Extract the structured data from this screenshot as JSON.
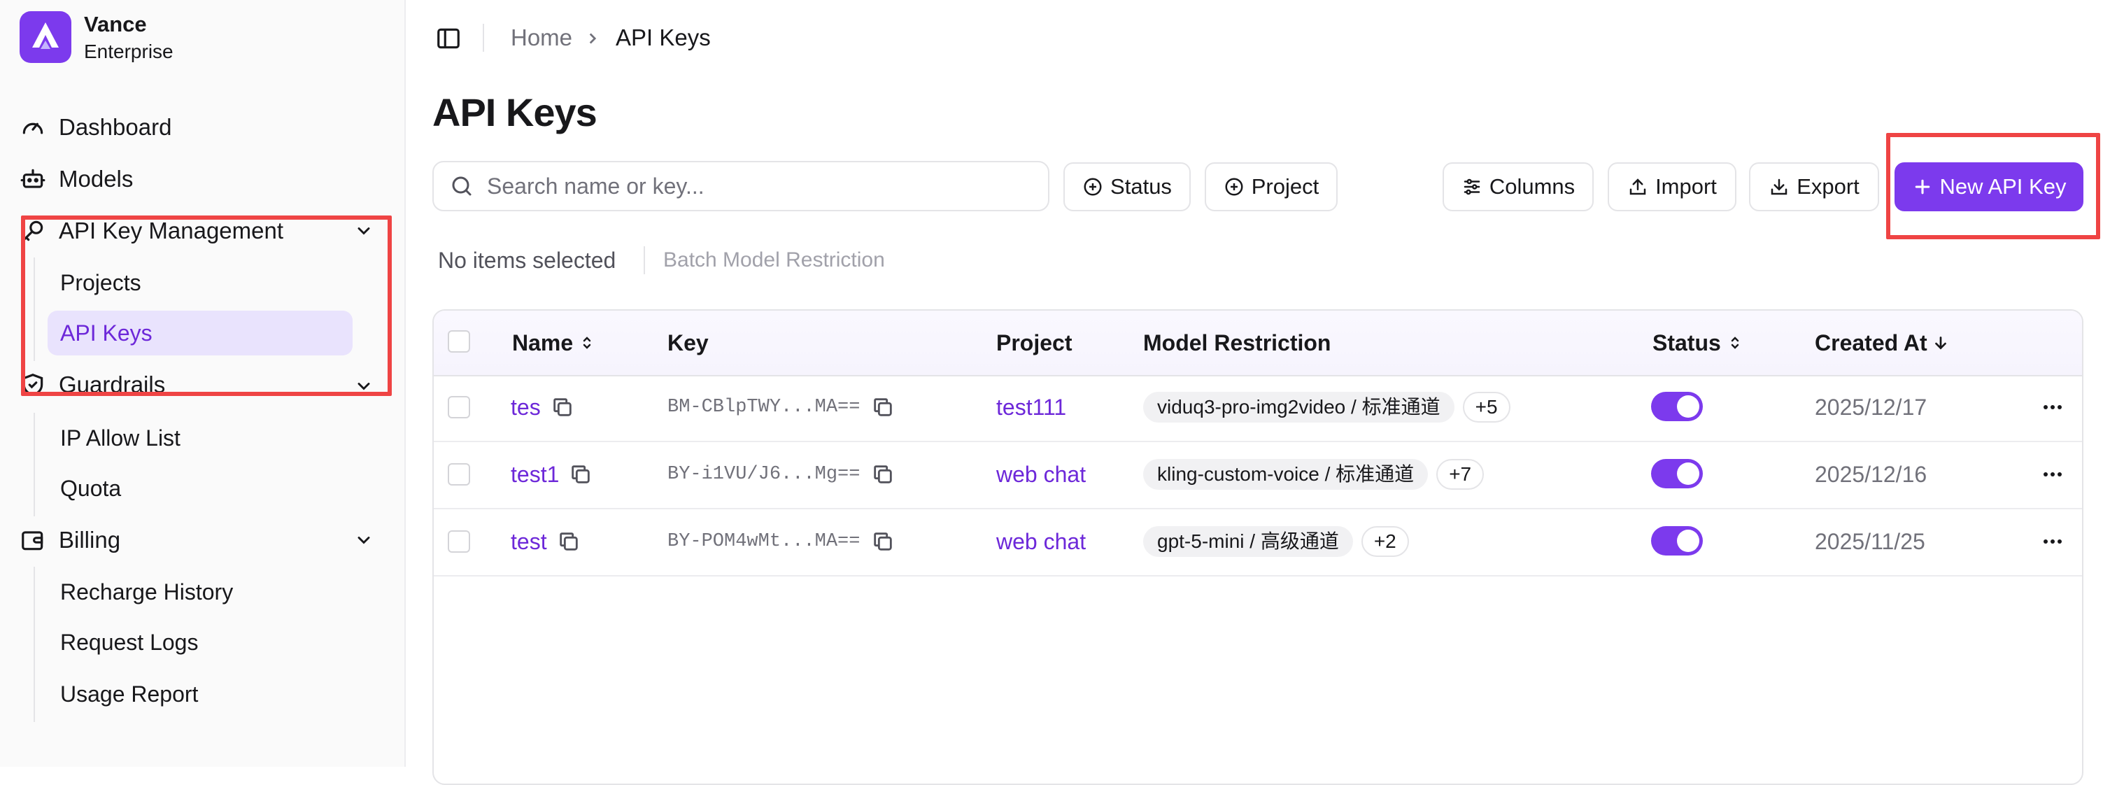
{
  "app": {
    "brand_name": "Vance",
    "brand_sub": "Enterprise",
    "accent": "#7c3aed",
    "highlight": "#ef4444"
  },
  "sidebar": {
    "items": [
      {
        "label": "Dashboard",
        "icon": "gauge-icon"
      },
      {
        "label": "Models",
        "icon": "robot-icon"
      },
      {
        "label": "API Key Management",
        "icon": "key-icon",
        "expanded": true,
        "children": [
          "Projects",
          "API Keys"
        ]
      },
      {
        "label": "Guardrails",
        "icon": "shield-icon",
        "expanded": true,
        "children": [
          "IP Allow List",
          "Quota"
        ]
      },
      {
        "label": "Billing",
        "icon": "wallet-icon",
        "expanded": true,
        "children": [
          "Recharge History",
          "Request Logs",
          "Usage Report"
        ]
      }
    ],
    "active": "API Keys"
  },
  "breadcrumb": {
    "home": "Home",
    "current": "API Keys"
  },
  "page": {
    "title": "API Keys"
  },
  "toolbar": {
    "search_placeholder": "Search name or key...",
    "status_filter": "Status",
    "project_filter": "Project",
    "columns": "Columns",
    "import": "Import",
    "export": "Export",
    "new_key": "New API Key"
  },
  "selection": {
    "status": "No items selected",
    "batch_action": "Batch Model Restriction"
  },
  "table": {
    "columns": [
      "Name",
      "Key",
      "Project",
      "Model Restriction",
      "Status",
      "Created At"
    ],
    "rows": [
      {
        "name": "tes",
        "key": "BM-CBlpTWY...MA==",
        "project": "test111",
        "model": "viduq3-pro-img2video / 标准通道",
        "extra": "+5",
        "enabled": true,
        "created": "2025/12/17"
      },
      {
        "name": "test1",
        "key": "BY-i1VU/J6...Mg==",
        "project": "web chat",
        "model": "kling-custom-voice / 标准通道",
        "extra": "+7",
        "enabled": true,
        "created": "2025/12/16"
      },
      {
        "name": "test",
        "key": "BY-POM4wMt...MA==",
        "project": "web chat",
        "model": "gpt-5-mini / 高级通道",
        "extra": "+2",
        "enabled": true,
        "created": "2025/11/25"
      }
    ]
  }
}
